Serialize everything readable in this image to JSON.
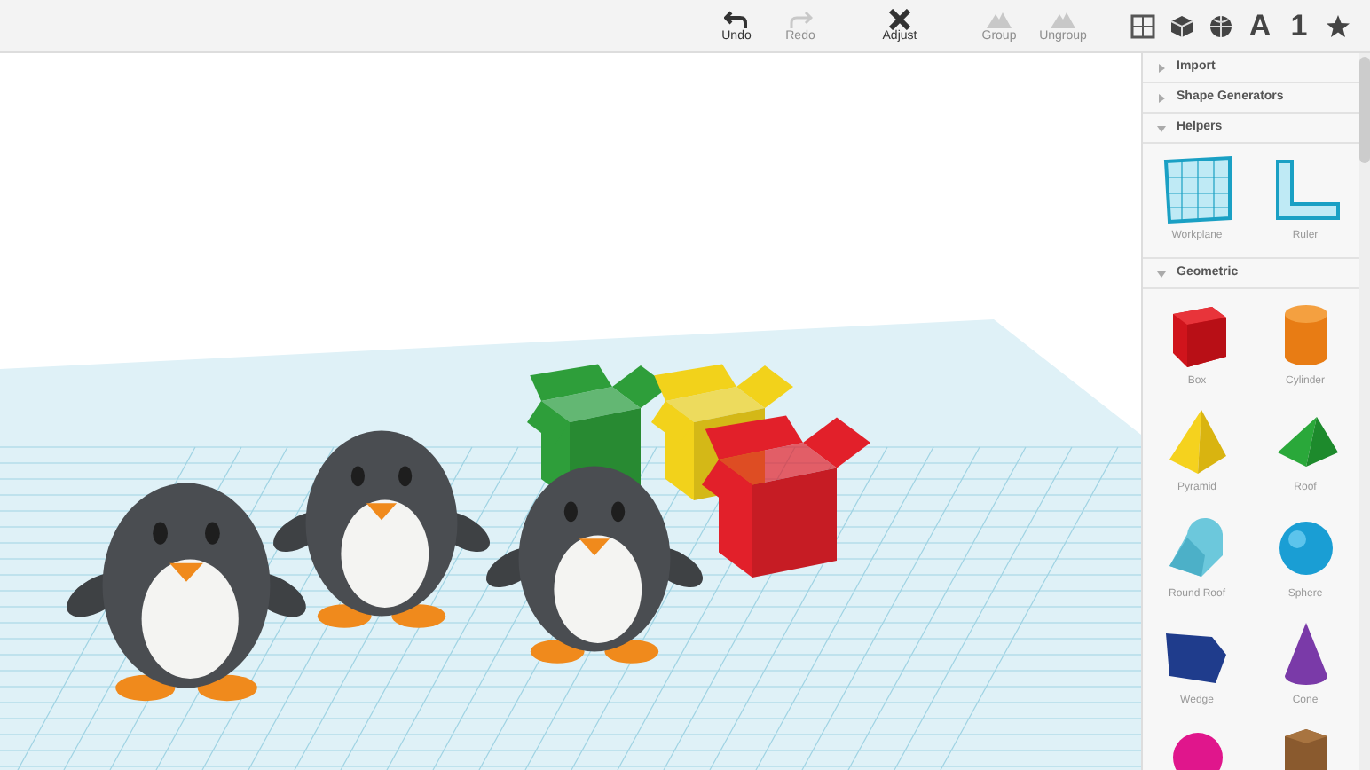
{
  "toolbar": {
    "actions": [
      {
        "label": "Undo",
        "kind": "undo",
        "disabled": false
      },
      {
        "label": "Redo",
        "kind": "redo",
        "disabled": true
      },
      {
        "label": "Adjust",
        "kind": "adjust",
        "disabled": false
      },
      {
        "label": "Group",
        "kind": "group",
        "disabled": true
      },
      {
        "label": "Ungroup",
        "kind": "ungroup",
        "disabled": true
      }
    ],
    "view_buttons": [
      {
        "kind": "grid"
      },
      {
        "kind": "cube"
      },
      {
        "kind": "globe"
      },
      {
        "kind": "text",
        "label": "A"
      },
      {
        "kind": "text",
        "label": "1"
      },
      {
        "kind": "star"
      }
    ]
  },
  "scene": {
    "boxes": [
      {
        "color": "#2e9e3a"
      },
      {
        "color": "#f2d21b"
      },
      {
        "color": "#e2202a"
      }
    ]
  },
  "sidebar": {
    "sections": [
      {
        "title": "Import",
        "expanded": false
      },
      {
        "title": "Shape Generators",
        "expanded": false
      },
      {
        "title": "Helpers",
        "expanded": true,
        "items": [
          {
            "label": "Workplane",
            "kind": "workplane"
          },
          {
            "label": "Ruler",
            "kind": "ruler"
          }
        ]
      },
      {
        "title": "Geometric",
        "expanded": true,
        "items": [
          {
            "label": "Box",
            "kind": "box"
          },
          {
            "label": "Cylinder",
            "kind": "cylinder"
          },
          {
            "label": "Pyramid",
            "kind": "pyramid"
          },
          {
            "label": "Roof",
            "kind": "roof"
          },
          {
            "label": "Round Roof",
            "kind": "roundroof"
          },
          {
            "label": "Sphere",
            "kind": "sphere"
          },
          {
            "label": "Wedge",
            "kind": "wedge"
          },
          {
            "label": "Cone",
            "kind": "cone"
          },
          {
            "kind": "halfsphere"
          },
          {
            "kind": "hexprism"
          }
        ]
      }
    ]
  }
}
